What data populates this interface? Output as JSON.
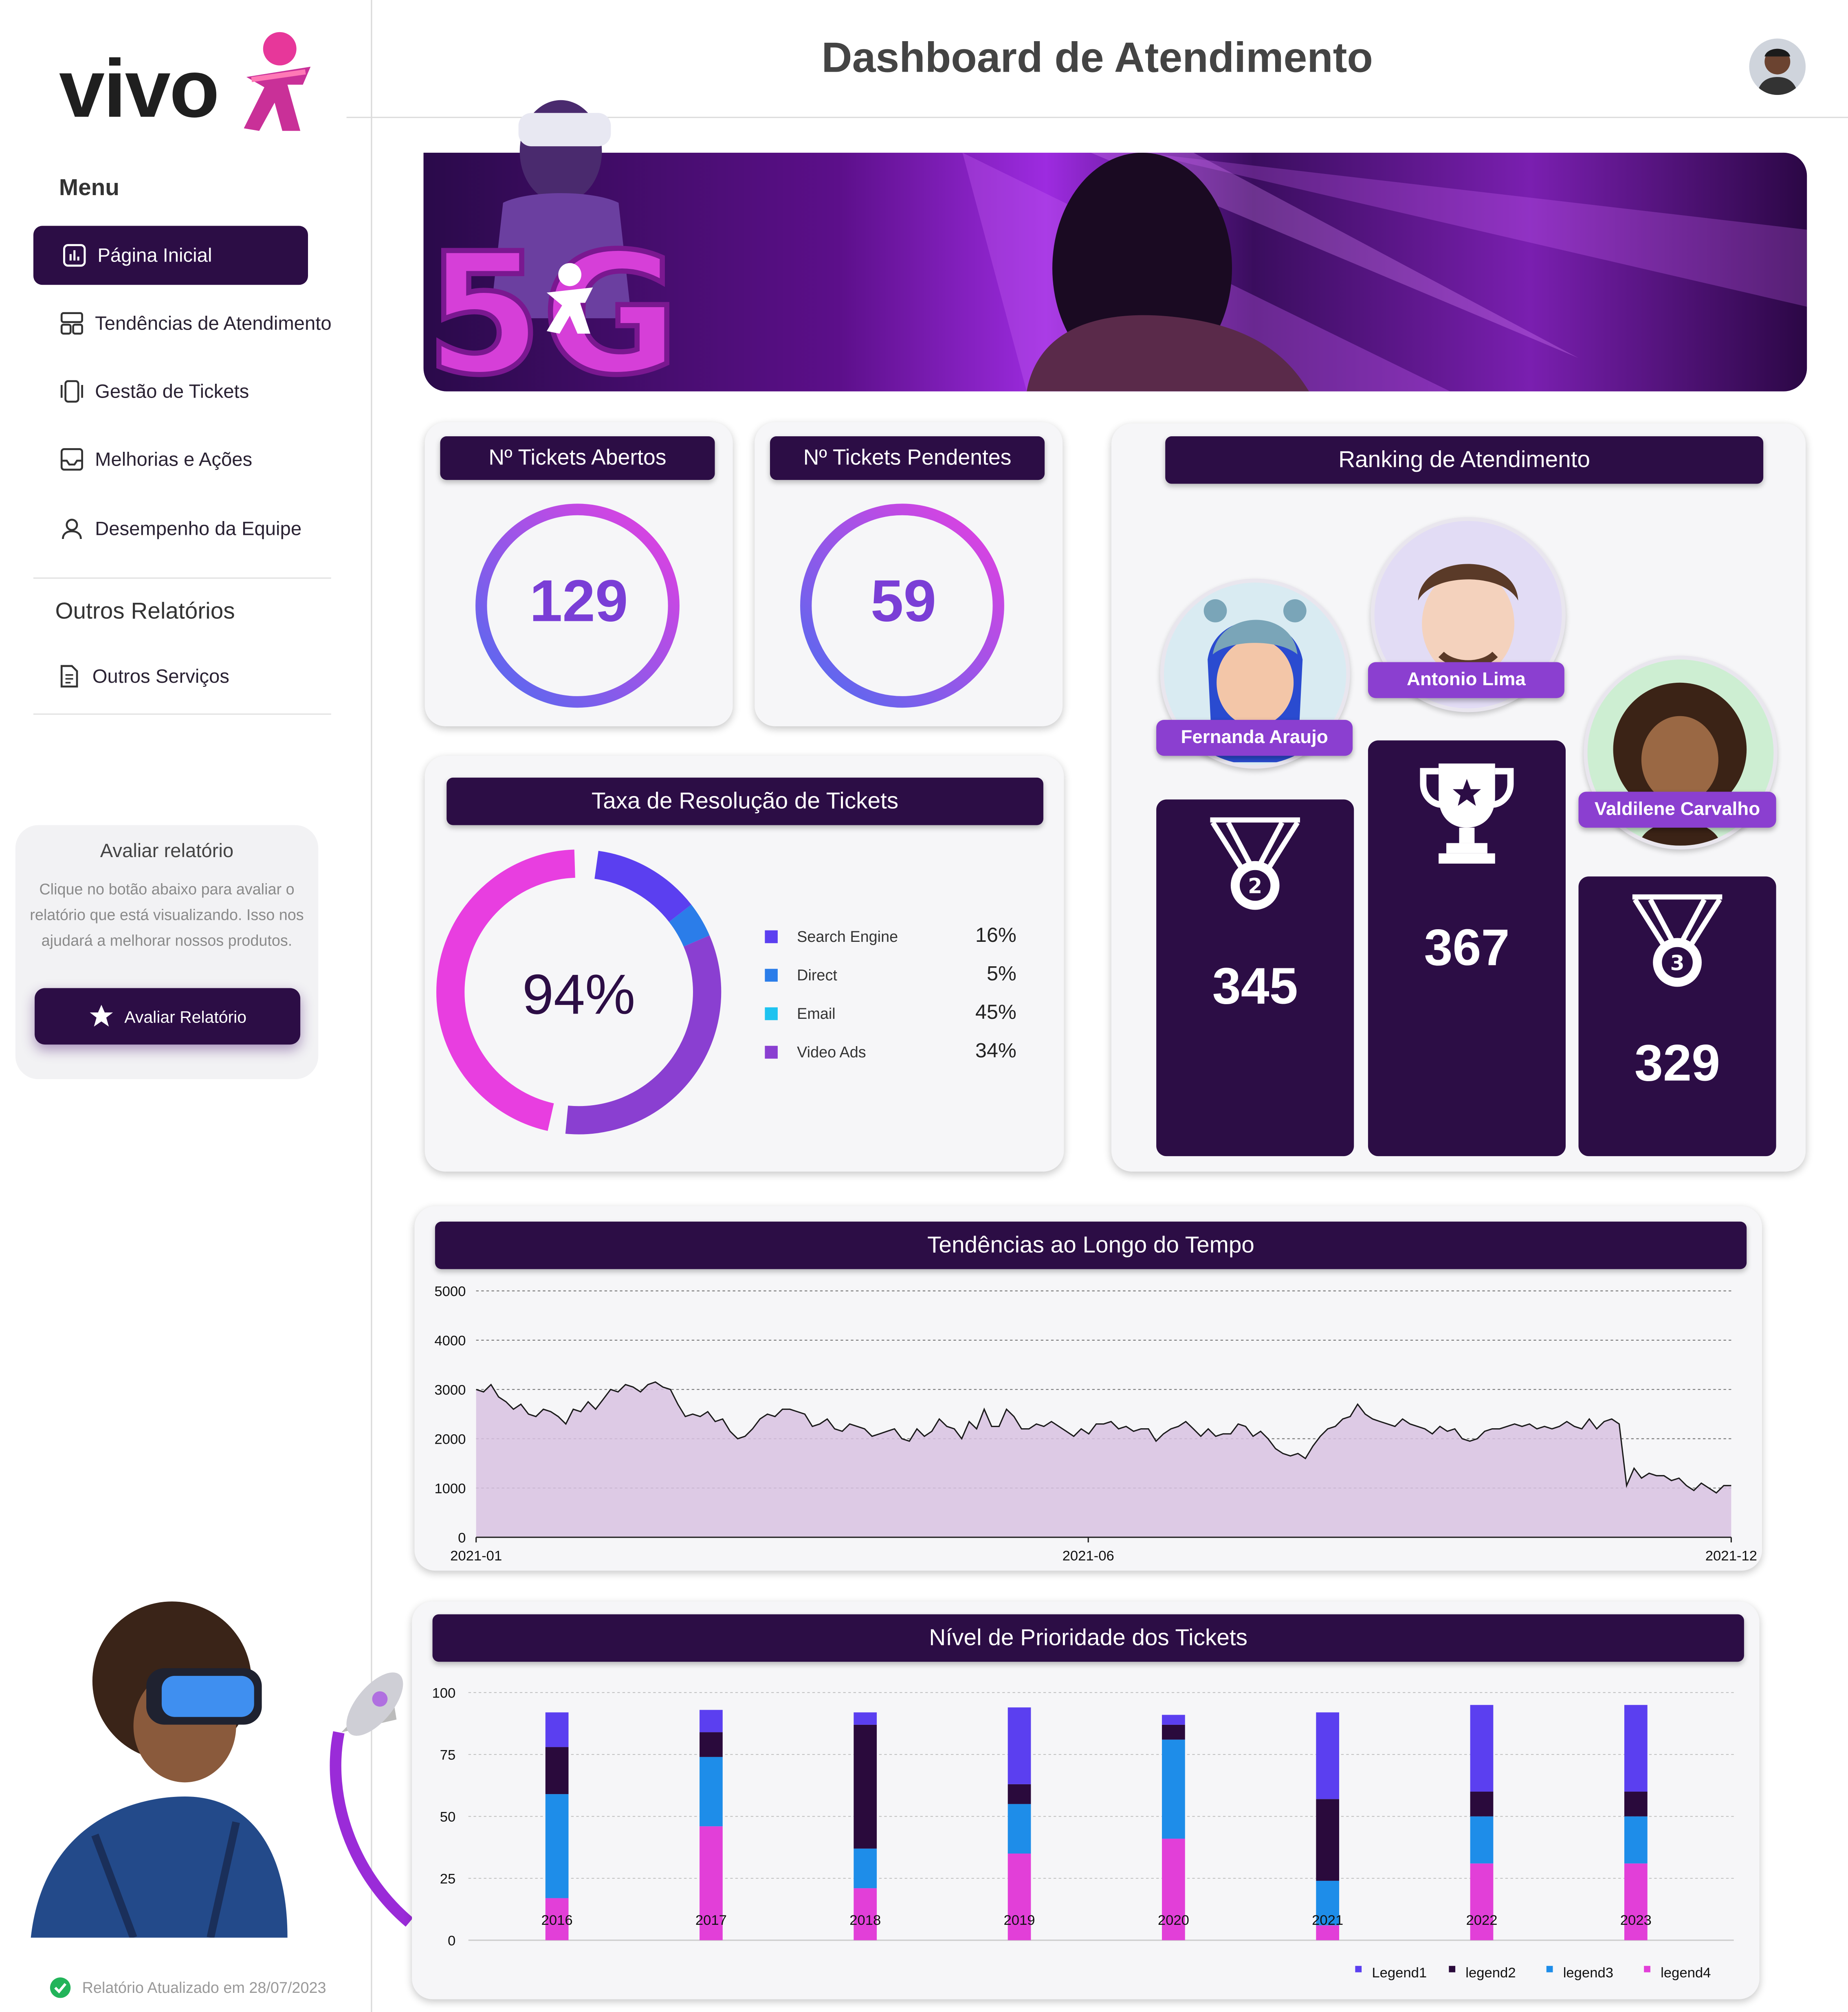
{
  "header": {
    "title": "Dashboard de Atendimento"
  },
  "brand": {
    "logo_text": "vivo"
  },
  "sidebar": {
    "menu_title": "Menu",
    "items": [
      {
        "label": "Página Inicial",
        "icon": "bar-chart-icon",
        "active": true
      },
      {
        "label": "Tendências de Atendimento",
        "icon": "layout-icon"
      },
      {
        "label": "Gestão de Tickets",
        "icon": "ticket-icon"
      },
      {
        "label": "Melhorias e Ações",
        "icon": "inbox-icon"
      },
      {
        "label": "Desempenho da Equipe",
        "icon": "user-icon"
      }
    ],
    "other_title": "Outros Relatórios",
    "other_items": [
      {
        "label": "Outros Serviços",
        "icon": "document-icon"
      }
    ],
    "feedback": {
      "title": "Avaliar relatório",
      "text": "Clique no botão abaixo para avaliar o relatório que está visualizando. Isso nos ajudará a melhorar nossos produtos.",
      "button": "Avaliar Relatório"
    },
    "updated": "Relatório Atualizado em 28/07/2023"
  },
  "kpis": {
    "open": {
      "title": "Nº Tickets Abertos",
      "value": "129"
    },
    "pending": {
      "title": "Nº Tickets Pendentes",
      "value": "59"
    }
  },
  "resolution": {
    "title": "Taxa de Resolução de Tickets",
    "center": "94%",
    "legend": [
      {
        "name": "Search Engine",
        "pct": "16%",
        "color": "#5b3ff0"
      },
      {
        "name": "Direct",
        "pct": "5%",
        "color": "#2b7de9"
      },
      {
        "name": "Email",
        "pct": "45%",
        "color": "#1ec3f0"
      },
      {
        "name": "Video Ads",
        "pct": "34%",
        "color": "#8a3fd1"
      }
    ]
  },
  "ranking": {
    "title": "Ranking de Atendimento",
    "people": [
      {
        "name": "Fernanda Araujo",
        "value": "345",
        "place": "2"
      },
      {
        "name": "Antonio Lima",
        "value": "367",
        "place": "1"
      },
      {
        "name": "Valdilene Carvalho",
        "value": "329",
        "place": "3"
      }
    ]
  },
  "chart_data": [
    {
      "type": "area",
      "title": "Tendências ao Longo do Tempo",
      "x_ticks": [
        "2021-01",
        "2021-06",
        "2021-12"
      ],
      "ylim": [
        0,
        5000
      ],
      "y_ticks": [
        0,
        1000,
        2000,
        3000,
        4000,
        5000
      ],
      "grid": true,
      "color": "#d8c2e2",
      "series": [
        {
          "values": [
            3000,
            2950,
            3100,
            2850,
            2750,
            2600,
            2700,
            2500,
            2450,
            2600,
            2550,
            2450,
            2300,
            2600,
            2550,
            2750,
            2600,
            2800,
            3000,
            2950,
            3100,
            3050,
            2950,
            3100,
            3150,
            3050,
            3000,
            2700,
            2450,
            2500,
            2450,
            2550,
            2350,
            2400,
            2150,
            2000,
            2050,
            2200,
            2400,
            2500,
            2450,
            2600,
            2600,
            2550,
            2500,
            2250,
            2300,
            2400,
            2200,
            2150,
            2300,
            2250,
            2200,
            2050,
            2100,
            2150,
            2200,
            2000,
            1950,
            2200,
            2050,
            2150,
            2400,
            2250,
            2200,
            2000,
            2350,
            2200,
            2600,
            2250,
            2250,
            2600,
            2450,
            2200,
            2200,
            2300,
            2250,
            2350,
            2250,
            2150,
            2050,
            2200,
            2100,
            2300,
            2300,
            2350,
            2200,
            2250,
            2150,
            2200,
            2200,
            1950,
            2100,
            2200,
            2250,
            2350,
            2200,
            2050,
            2200,
            2050,
            2100,
            2100,
            2300,
            2250,
            2050,
            2150,
            2000,
            1800,
            1700,
            1650,
            1700,
            1600,
            1850,
            2050,
            2200,
            2250,
            2400,
            2450,
            2700,
            2500,
            2400,
            2350,
            2300,
            2250,
            2400,
            2300,
            2250,
            2200,
            2100,
            2250,
            2150,
            2200,
            2000,
            1950,
            2000,
            2150,
            2200,
            2200,
            2250,
            2300,
            2250,
            2300,
            2200,
            2250,
            2200,
            2250,
            2350,
            2250,
            2200,
            2400,
            2200,
            2350,
            2400,
            2300,
            1050,
            1400,
            1200,
            1300,
            1250,
            1250,
            1150,
            1200,
            1050,
            950,
            1100,
            1000,
            900,
            1050,
            1050
          ]
        }
      ]
    },
    {
      "type": "bar",
      "stacked": true,
      "title": "Nível de Prioridade dos Tickets",
      "categories": [
        "2016",
        "2017",
        "2018",
        "2019",
        "2020",
        "2021",
        "2022",
        "2023"
      ],
      "ylim": [
        0,
        100
      ],
      "y_ticks": [
        0,
        25,
        50,
        75,
        100
      ],
      "series": [
        {
          "name": "legend4",
          "color": "#e23fd8",
          "values": [
            17,
            46,
            21,
            35,
            41,
            6,
            31,
            31
          ]
        },
        {
          "name": "legend3",
          "color": "#1e8de9",
          "values": [
            42,
            28,
            16,
            20,
            40,
            18,
            19,
            19
          ]
        },
        {
          "name": "legend2",
          "color": "#2a0a3c",
          "values": [
            19,
            10,
            50,
            8,
            6,
            33,
            10,
            10
          ]
        },
        {
          "name": "Legend1",
          "color": "#5b3ff0",
          "values": [
            14,
            9,
            5,
            31,
            4,
            35,
            35,
            35
          ]
        }
      ]
    }
  ]
}
